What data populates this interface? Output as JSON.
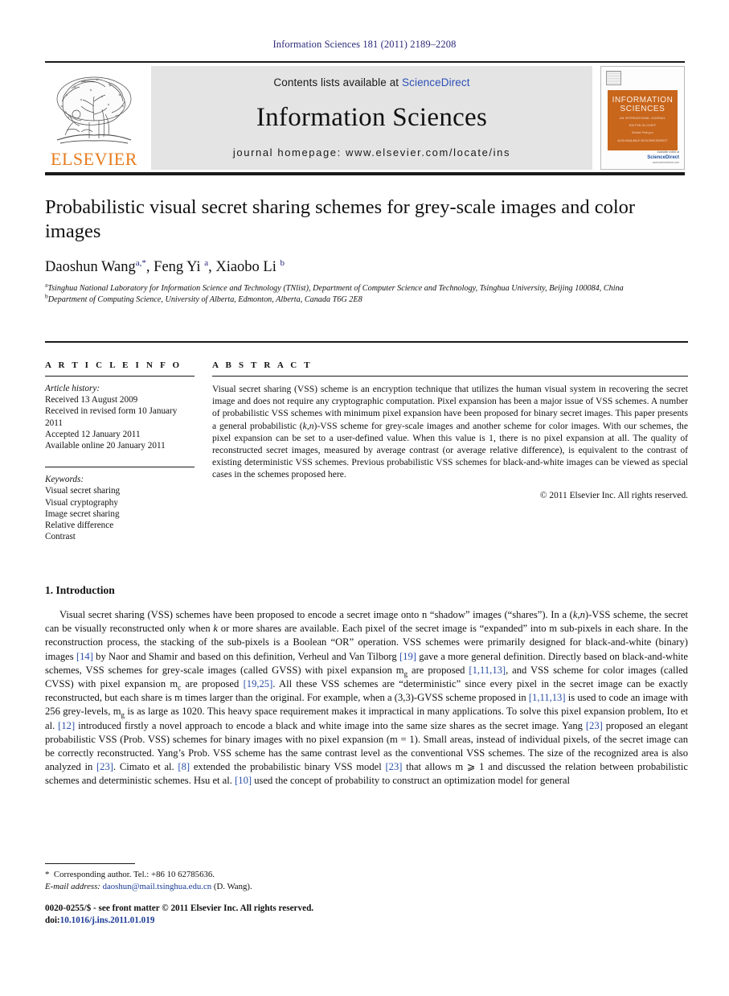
{
  "running_head": "Information Sciences 181 (2011) 2189–2208",
  "masthead": {
    "publisher_name": "ELSEVIER",
    "contents_prefix": "Contents lists available at ",
    "contents_link": "ScienceDirect",
    "journal_name": "Information Sciences",
    "homepage": "journal homepage: www.elsevier.com/locate/ins",
    "cover": {
      "line1": "INFORMATION",
      "line2": "SCIENCES",
      "line3": "AN INTERNATIONAL JOURNAL",
      "line4": "EDITOR-IN-CHIEF",
      "line5": "Witold Pedrycz",
      "line6": "ALSO AVAILABLE ON SCIENCEDIRECT",
      "sd_avail": "Available online at",
      "sd_name": "ScienceDirect",
      "sd_url": "www.sciencedirect.com"
    }
  },
  "article": {
    "title": "Probabilistic visual secret sharing schemes for grey-scale images and color images",
    "authors_html": "Daoshun Wang<sup>a,*</sup>, Feng Yi <sup>a</sup>, Xiaobo Li <sup>b</sup>",
    "affiliations": [
      {
        "marker": "a",
        "text": "Tsinghua National Laboratory for Information Science and Technology (TNlist), Department of Computer Science and Technology, Tsinghua University, Beijing 100084, China"
      },
      {
        "marker": "b",
        "text": "Department of Computing Science, University of Alberta, Edmonton, Alberta, Canada T6G 2E8"
      }
    ]
  },
  "article_info": {
    "heading": "A R T I C L E    I N F O",
    "history_label": "Article history:",
    "history": [
      "Received 13 August 2009",
      "Received in revised form 10 January 2011",
      "Accepted 12 January 2011",
      "Available online 20 January 2011"
    ],
    "keywords_label": "Keywords:",
    "keywords": [
      "Visual secret sharing",
      "Visual cryptography",
      "Image secret sharing",
      "Relative difference",
      "Contrast"
    ]
  },
  "abstract": {
    "heading": "A B S T R A C T",
    "text_html": "Visual secret sharing (VSS) scheme is an encryption technique that utilizes the human visual system in recovering the secret image and does not require any cryptographic computation. Pixel expansion has been a major issue of VSS schemes. A number of probabilistic VSS schemes with minimum pixel expansion have been proposed for binary secret images. This paper presents a general probabilistic (<i>k</i>,<i>n</i>)-VSS scheme for grey-scale images and another scheme for color images. With our schemes, the pixel expansion can be set to a user-defined value. When this value is 1, there is no pixel expansion at all. The quality of reconstructed secret images, measured by average contrast (or average relative difference), is equivalent to the contrast of existing deterministic VSS schemes. Previous probabilistic VSS schemes for black-and-white images can be viewed as special cases in the schemes proposed here.",
    "copyright": "© 2011 Elsevier Inc. All rights reserved."
  },
  "section": {
    "number_title": "1. Introduction",
    "paragraph_html": "Visual secret sharing (VSS) schemes have been proposed to encode a secret image onto n “shadow” images (“shares”). In a (<i>k</i>,<i>n</i>)-VSS scheme, the secret can be visually reconstructed only when <i>k</i> or more shares are available. Each pixel of the secret image is “expanded” into m sub-pixels in each share. In the reconstruction process, the stacking of the sub-pixels is a Boolean “OR” operation. VSS schemes were primarily designed for black-and-white (binary) images <span class=\"ref\">[14]</span> by Naor and Shamir and based on this definition, Verheul and Van Tilborg <span class=\"ref\">[19]</span> gave a more general definition. Directly based on black-and-white schemes, VSS schemes for grey-scale images (called GVSS) with pixel expansion m<sub>g</sub> are proposed <span class=\"ref\">[1,11,13]</span>, and VSS scheme for color images (called CVSS) with pixel expansion m<sub>c</sub> are proposed <span class=\"ref\">[19,25]</span>. All these VSS schemes are “deterministic” since every pixel in the secret image can be exactly reconstructed, but each share is m times larger than the original. For example, when a (3,3)-GVSS scheme proposed in <span class=\"ref\">[1,11,13]</span> is used to code an image with 256 grey-levels, m<sub>g</sub> is as large as 1020. This heavy space requirement makes it impractical in many applications. To solve this pixel expansion problem, Ito et al. <span class=\"ref\">[12]</span> introduced firstly a novel approach to encode a black and white image into the same size shares as the secret image. Yang <span class=\"ref\">[23]</span> proposed an elegant probabilistic VSS (Prob. VSS) schemes for binary images with no pixel expansion (m = 1). Small areas, instead of individual pixels, of the secret image can be correctly reconstructed. Yang’s Prob. VSS scheme has the same contrast level as the conventional VSS schemes. The size of the recognized area is also analyzed in <span class=\"ref\">[23]</span>. Cimato et al. <span class=\"ref\">[8]</span> extended the probabilistic binary VSS model <span class=\"ref\">[23]</span> that allows m ⩾ 1 and discussed the relation between probabilistic schemes and deterministic schemes. Hsu et al. <span class=\"ref\">[10]</span> used the concept of probability to construct an optimization model for general"
  },
  "footnotes": {
    "corresponding_html": "<span class=\"star\">*</span>&nbsp; Corresponding author. Tel.: +86 10 62785636.",
    "email_html": "<i>E-mail address:</i> <span class=\"fn-mail\">daoshun@mail.tsinghua.edu.cn</span> (D. Wang)."
  },
  "imprint": {
    "line1_html": "0020-0255/$ - see front matter © 2011 Elsevier Inc. All rights reserved.",
    "doi_prefix": "doi:",
    "doi_value": "10.1016/j.ins.2011.01.019"
  }
}
